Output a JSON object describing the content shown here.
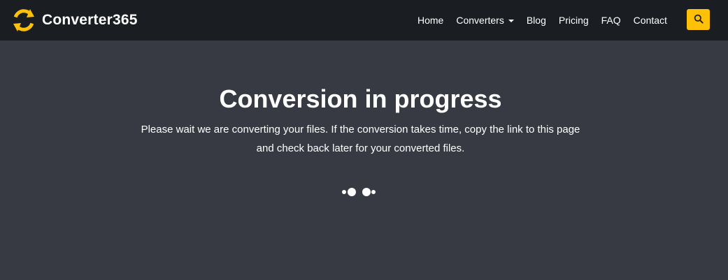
{
  "header": {
    "brand": "Converter365",
    "nav": [
      {
        "label": "Home"
      },
      {
        "label": "Converters",
        "has_dropdown": true
      },
      {
        "label": "Blog"
      },
      {
        "label": "Pricing"
      },
      {
        "label": "FAQ"
      },
      {
        "label": "Contact"
      }
    ],
    "search_icon": "search-icon"
  },
  "main": {
    "title": "Conversion in progress",
    "description": "Please wait we are converting your files. If the conversion takes time, copy the link to this page and check back later for your converted files."
  },
  "colors": {
    "navbar_bg": "#1a1d21",
    "page_bg": "#373a42",
    "accent": "#ffc107",
    "text": "#ffffff"
  }
}
